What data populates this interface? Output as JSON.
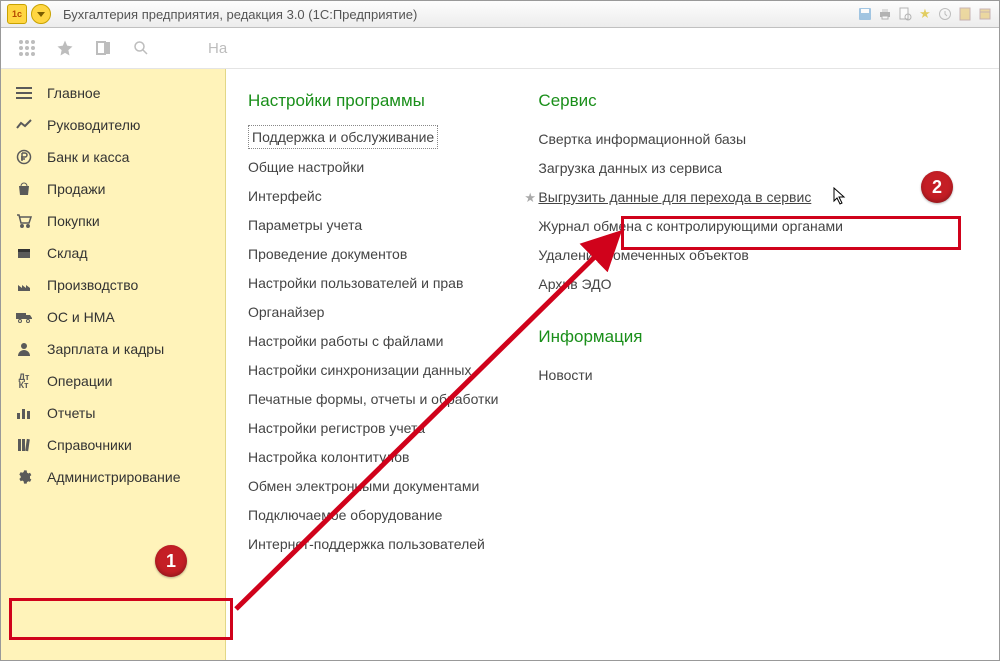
{
  "title": "Бухгалтерия предприятия, редакция 3.0  (1С:Предприятие)",
  "search": {
    "placeholder": "На"
  },
  "sidebar": {
    "items": [
      {
        "label": "Главное",
        "icon": "menu"
      },
      {
        "label": "Руководителю",
        "icon": "chart"
      },
      {
        "label": "Банк и касса",
        "icon": "ruble"
      },
      {
        "label": "Продажи",
        "icon": "bag"
      },
      {
        "label": "Покупки",
        "icon": "cart"
      },
      {
        "label": "Склад",
        "icon": "box"
      },
      {
        "label": "Производство",
        "icon": "factory"
      },
      {
        "label": "ОС и НМА",
        "icon": "truck"
      },
      {
        "label": "Зарплата и кадры",
        "icon": "user"
      },
      {
        "label": "Операции",
        "icon": "dtct"
      },
      {
        "label": "Отчеты",
        "icon": "bars"
      },
      {
        "label": "Справочники",
        "icon": "books"
      },
      {
        "label": "Администрирование",
        "icon": "gear"
      }
    ]
  },
  "panel": {
    "col1": {
      "heading": "Настройки программы",
      "links": [
        "Поддержка и обслуживание",
        "Общие настройки",
        "Интерфейс",
        "Параметры учета",
        "Проведение документов",
        "Настройки пользователей и прав",
        "Органайзер",
        "Настройки работы с файлами",
        "Настройки синхронизации данных",
        "Печатные формы, отчеты и обработки",
        "Настройки регистров учета",
        "Настройка колонтитулов",
        "Обмен электронными документами",
        "Подключаемое оборудование",
        "Интернет-поддержка пользователей"
      ]
    },
    "col2": {
      "heading": "Сервис",
      "links": [
        "Свертка информационной базы",
        "Загрузка данных из сервиса",
        "Выгрузить данные для перехода в сервис",
        "Журнал обмена с контролирующими органами",
        "Удаление помеченных объектов",
        "Архив ЭДО"
      ]
    },
    "col3": {
      "heading": "Информация",
      "links": [
        "Новости"
      ]
    }
  },
  "annotations": {
    "badge1": "1",
    "badge2": "2"
  }
}
